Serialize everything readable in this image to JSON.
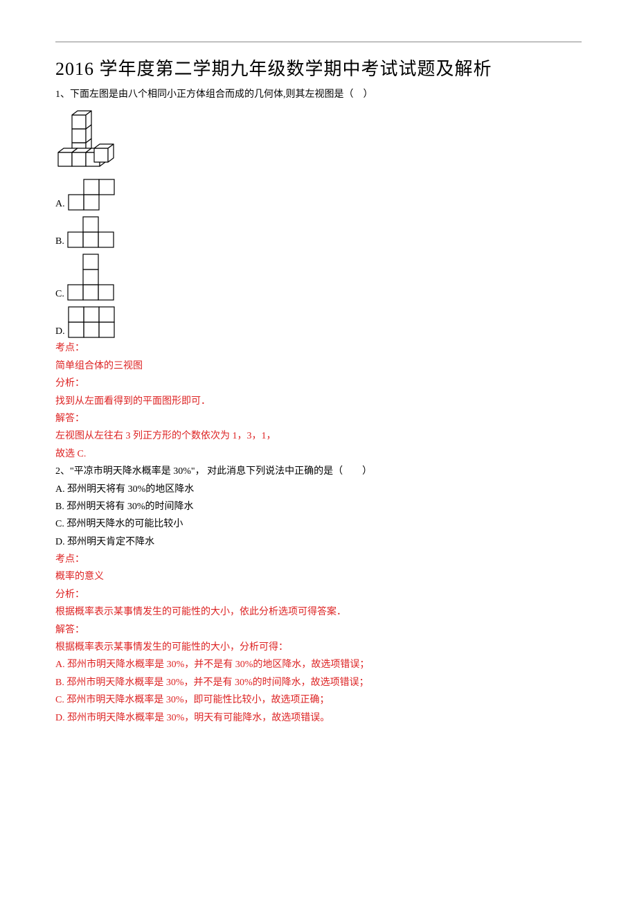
{
  "title": "2016 学年度第二学期九年级数学期中考试试题及解析",
  "q1": {
    "stem": "1、下面左图是由八个相同小正方体组合而成的几何体,则其左视图是（　）",
    "options": {
      "A": "A.",
      "B": "B.",
      "C": "C.",
      "D": "D."
    },
    "kaodian_label": "考点：",
    "kaodian_text": "简单组合体的三视图",
    "fenxi_label": "分析：",
    "fenxi_text": "找到从左面看得到的平面图形即可．",
    "jieda_label": "解答：",
    "jieda_text1": "左视图从左往右 3 列正方形的个数依次为 1，3，1，",
    "jieda_text2": "故选 C."
  },
  "q2": {
    "stem": "2、\"平凉市明天降水概率是 30%\"，  对此消息下列说法中正确的是（　　）",
    "optA": "A. 邳州明天将有 30%的地区降水",
    "optB": "B. 邳州明天将有 30%的时间降水",
    "optC": "C. 邳州明天降水的可能比较小",
    "optD": "D. 邳州明天肯定不降水",
    "kaodian_label": "考点：",
    "kaodian_text": "概率的意义",
    "fenxi_label": "分析：",
    "fenxi_text": "根据概率表示某事情发生的可能性的大小，依此分析选项可得答案．",
    "jieda_label": "解答：",
    "jieda_text1": "根据概率表示某事情发生的可能性的大小，分析可得：",
    "jieda_A": "A. 邳州市明天降水概率是 30%，并不是有 30%的地区降水，故选项错误；",
    "jieda_B": "B. 邳州市明天降水概率是 30%，并不是有 30%的时间降水，故选项错误；",
    "jieda_C": "C. 邳州市明天降水概率是 30%，即可能性比较小，故选项正确；",
    "jieda_D": "D. 邳州市明天降水概率是 30%，明天有可能降水，故选项错误。"
  }
}
